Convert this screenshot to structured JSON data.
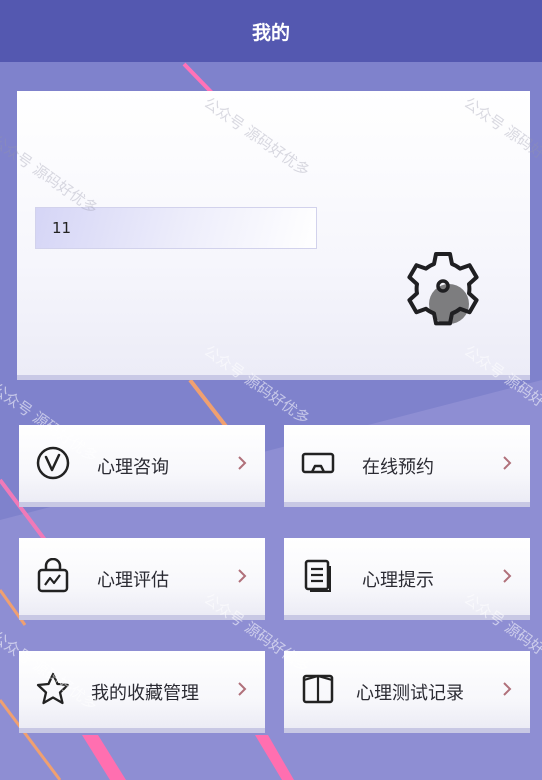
{
  "header": {
    "title": "我的"
  },
  "profile": {
    "username": "11",
    "settings_icon": "gear-icon"
  },
  "menu": [
    {
      "label": "心理咨询",
      "icon": "clock-v-icon",
      "arrow": "chevron-right-icon"
    },
    {
      "label": "在线预约",
      "icon": "vr-headset-icon",
      "arrow": "chevron-right-icon"
    },
    {
      "label": "心理评估",
      "icon": "bag-chart-icon",
      "arrow": "chevron-right-icon"
    },
    {
      "label": "心理提示",
      "icon": "document-icon",
      "arrow": "chevron-right-icon"
    },
    {
      "label": "我的收藏管理",
      "icon": "star-icon",
      "arrow": "chevron-right-icon"
    },
    {
      "label": "心理测试记录",
      "icon": "book-icon",
      "arrow": "chevron-right-icon"
    }
  ],
  "watermark": "公众号 源码好优多",
  "colors": {
    "header": "#5458b0",
    "background": "#8f8fd2",
    "accent_stripe": "#ff6fb0"
  }
}
